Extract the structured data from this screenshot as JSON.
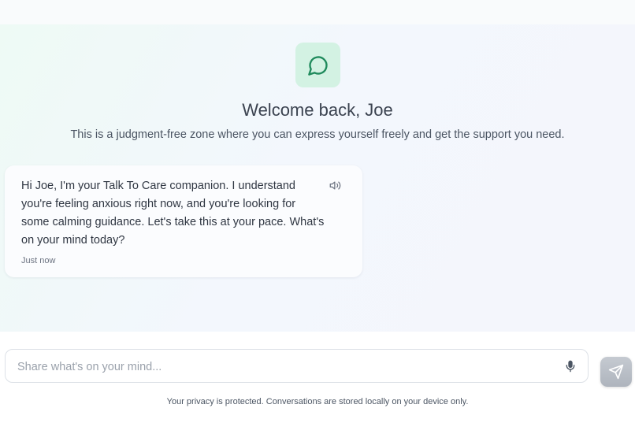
{
  "header": {
    "logo_icon": "chat-bubble-icon",
    "title": "Welcome back, Joe",
    "subtitle": "This is a judgment-free zone where you can express yourself freely and get the support you need."
  },
  "messages": [
    {
      "text": "Hi Joe, I'm your Talk To Care companion. I understand you're feeling anxious right now, and you're looking for some calming guidance. Let's take this at your pace. What's on your mind today?",
      "time": "Just now",
      "action_icon": "speaker-icon"
    }
  ],
  "composer": {
    "placeholder": "Share what's on your mind...",
    "mic_icon": "microphone-icon",
    "send_icon": "send-icon"
  },
  "footer": {
    "privacy": "Your privacy is protected. Conversations are stored locally on your device only."
  },
  "colors": {
    "accent": "#1f8a5c",
    "logo_tile": "#d3f2e3",
    "send_button": "#b8bdc5"
  }
}
